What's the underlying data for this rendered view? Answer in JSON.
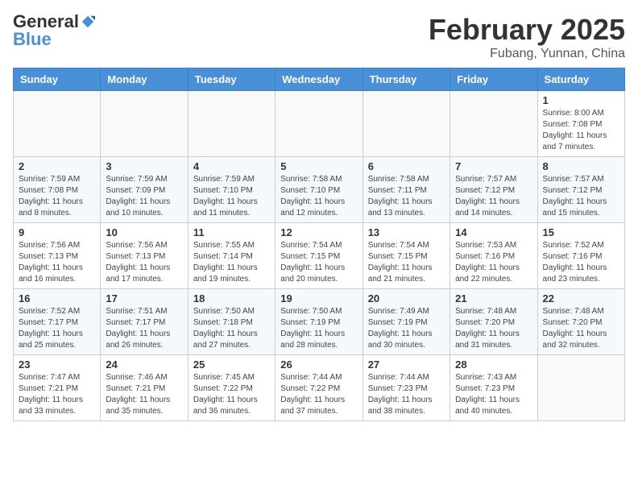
{
  "header": {
    "logo_general": "General",
    "logo_blue": "Blue",
    "month_year": "February 2025",
    "location": "Fubang, Yunnan, China"
  },
  "days_of_week": [
    "Sunday",
    "Monday",
    "Tuesday",
    "Wednesday",
    "Thursday",
    "Friday",
    "Saturday"
  ],
  "weeks": [
    [
      {
        "day": "",
        "info": ""
      },
      {
        "day": "",
        "info": ""
      },
      {
        "day": "",
        "info": ""
      },
      {
        "day": "",
        "info": ""
      },
      {
        "day": "",
        "info": ""
      },
      {
        "day": "",
        "info": ""
      },
      {
        "day": "1",
        "info": "Sunrise: 8:00 AM\nSunset: 7:08 PM\nDaylight: 11 hours\nand 7 minutes."
      }
    ],
    [
      {
        "day": "2",
        "info": "Sunrise: 7:59 AM\nSunset: 7:08 PM\nDaylight: 11 hours\nand 8 minutes."
      },
      {
        "day": "3",
        "info": "Sunrise: 7:59 AM\nSunset: 7:09 PM\nDaylight: 11 hours\nand 10 minutes."
      },
      {
        "day": "4",
        "info": "Sunrise: 7:59 AM\nSunset: 7:10 PM\nDaylight: 11 hours\nand 11 minutes."
      },
      {
        "day": "5",
        "info": "Sunrise: 7:58 AM\nSunset: 7:10 PM\nDaylight: 11 hours\nand 12 minutes."
      },
      {
        "day": "6",
        "info": "Sunrise: 7:58 AM\nSunset: 7:11 PM\nDaylight: 11 hours\nand 13 minutes."
      },
      {
        "day": "7",
        "info": "Sunrise: 7:57 AM\nSunset: 7:12 PM\nDaylight: 11 hours\nand 14 minutes."
      },
      {
        "day": "8",
        "info": "Sunrise: 7:57 AM\nSunset: 7:12 PM\nDaylight: 11 hours\nand 15 minutes."
      }
    ],
    [
      {
        "day": "9",
        "info": "Sunrise: 7:56 AM\nSunset: 7:13 PM\nDaylight: 11 hours\nand 16 minutes."
      },
      {
        "day": "10",
        "info": "Sunrise: 7:56 AM\nSunset: 7:13 PM\nDaylight: 11 hours\nand 17 minutes."
      },
      {
        "day": "11",
        "info": "Sunrise: 7:55 AM\nSunset: 7:14 PM\nDaylight: 11 hours\nand 19 minutes."
      },
      {
        "day": "12",
        "info": "Sunrise: 7:54 AM\nSunset: 7:15 PM\nDaylight: 11 hours\nand 20 minutes."
      },
      {
        "day": "13",
        "info": "Sunrise: 7:54 AM\nSunset: 7:15 PM\nDaylight: 11 hours\nand 21 minutes."
      },
      {
        "day": "14",
        "info": "Sunrise: 7:53 AM\nSunset: 7:16 PM\nDaylight: 11 hours\nand 22 minutes."
      },
      {
        "day": "15",
        "info": "Sunrise: 7:52 AM\nSunset: 7:16 PM\nDaylight: 11 hours\nand 23 minutes."
      }
    ],
    [
      {
        "day": "16",
        "info": "Sunrise: 7:52 AM\nSunset: 7:17 PM\nDaylight: 11 hours\nand 25 minutes."
      },
      {
        "day": "17",
        "info": "Sunrise: 7:51 AM\nSunset: 7:17 PM\nDaylight: 11 hours\nand 26 minutes."
      },
      {
        "day": "18",
        "info": "Sunrise: 7:50 AM\nSunset: 7:18 PM\nDaylight: 11 hours\nand 27 minutes."
      },
      {
        "day": "19",
        "info": "Sunrise: 7:50 AM\nSunset: 7:19 PM\nDaylight: 11 hours\nand 28 minutes."
      },
      {
        "day": "20",
        "info": "Sunrise: 7:49 AM\nSunset: 7:19 PM\nDaylight: 11 hours\nand 30 minutes."
      },
      {
        "day": "21",
        "info": "Sunrise: 7:48 AM\nSunset: 7:20 PM\nDaylight: 11 hours\nand 31 minutes."
      },
      {
        "day": "22",
        "info": "Sunrise: 7:48 AM\nSunset: 7:20 PM\nDaylight: 11 hours\nand 32 minutes."
      }
    ],
    [
      {
        "day": "23",
        "info": "Sunrise: 7:47 AM\nSunset: 7:21 PM\nDaylight: 11 hours\nand 33 minutes."
      },
      {
        "day": "24",
        "info": "Sunrise: 7:46 AM\nSunset: 7:21 PM\nDaylight: 11 hours\nand 35 minutes."
      },
      {
        "day": "25",
        "info": "Sunrise: 7:45 AM\nSunset: 7:22 PM\nDaylight: 11 hours\nand 36 minutes."
      },
      {
        "day": "26",
        "info": "Sunrise: 7:44 AM\nSunset: 7:22 PM\nDaylight: 11 hours\nand 37 minutes."
      },
      {
        "day": "27",
        "info": "Sunrise: 7:44 AM\nSunset: 7:23 PM\nDaylight: 11 hours\nand 38 minutes."
      },
      {
        "day": "28",
        "info": "Sunrise: 7:43 AM\nSunset: 7:23 PM\nDaylight: 11 hours\nand 40 minutes."
      },
      {
        "day": "",
        "info": ""
      }
    ]
  ]
}
